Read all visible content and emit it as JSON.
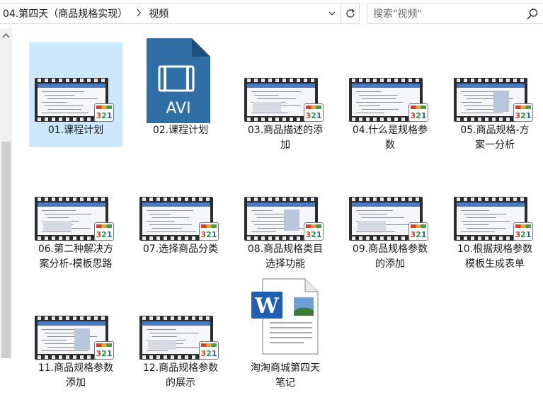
{
  "address": {
    "crumbs": [
      "04.第四天（商品规格实现）",
      "视频"
    ]
  },
  "search": {
    "placeholder": "搜索\"视频\""
  },
  "files": [
    {
      "label_line1": "01.课程计划",
      "label_line2": "",
      "type": "video",
      "selected": true
    },
    {
      "label_line1": "02.课程计划",
      "label_line2": "",
      "type": "avi",
      "selected": false
    },
    {
      "label_line1": "03.商品描述的添",
      "label_line2": "加",
      "type": "video",
      "selected": false
    },
    {
      "label_line1": "04.什么是规格参",
      "label_line2": "数",
      "type": "video",
      "selected": false
    },
    {
      "label_line1": "05.商品规格-方",
      "label_line2": "案一分析",
      "type": "video",
      "selected": false
    },
    {
      "label_line1": "06.第二种解决方",
      "label_line2": "案分析-模板思路",
      "type": "video",
      "selected": false
    },
    {
      "label_line1": "07.选择商品分类",
      "label_line2": "",
      "type": "video",
      "selected": false
    },
    {
      "label_line1": "08.商品规格类目",
      "label_line2": "选择功能",
      "type": "video",
      "selected": false
    },
    {
      "label_line1": "09.商品规格参数",
      "label_line2": "的添加",
      "type": "video",
      "selected": false
    },
    {
      "label_line1": "10.根据规格参数",
      "label_line2": "模板生成表单",
      "type": "video",
      "selected": false
    },
    {
      "label_line1": "11.商品规格参数",
      "label_line2": "添加",
      "type": "video",
      "selected": false
    },
    {
      "label_line1": "12.商品规格参数",
      "label_line2": "的展示",
      "type": "video",
      "selected": false
    },
    {
      "label_line1": "淘淘商城第四天",
      "label_line2": "笔记",
      "type": "word",
      "selected": false
    }
  ],
  "icons": {
    "avi_label": "AVI",
    "badge_text": [
      "3",
      "2",
      "1"
    ]
  },
  "colors": {
    "selection": "#cce8ff",
    "avi_blue": "#2f6fa6",
    "word_blue": "#1e5eb5"
  }
}
